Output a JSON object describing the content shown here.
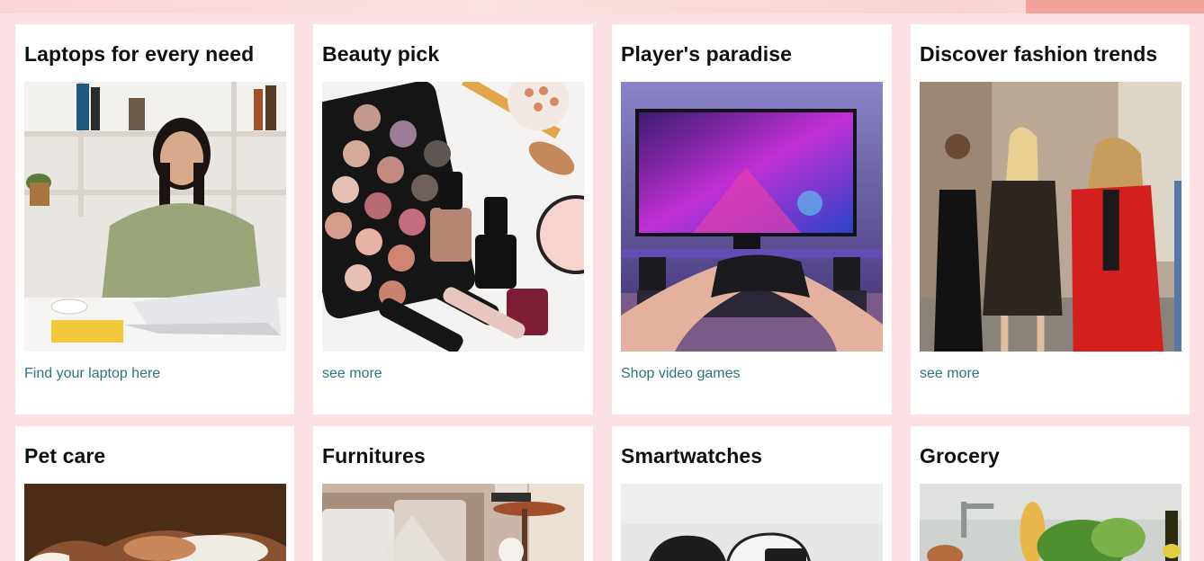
{
  "cards": [
    {
      "title": "Laptops for every need",
      "link": "Find your laptop here",
      "image": "woman-with-laptop-photo"
    },
    {
      "title": "Beauty pick",
      "link": "see more",
      "image": "makeup-products-photo"
    },
    {
      "title": "Player's paradise",
      "link": "Shop video games",
      "image": "gamer-with-controller-photo"
    },
    {
      "title": "Discover fashion trends",
      "link": "see more",
      "image": "fashion-street-style-photo"
    },
    {
      "title": "Pet care",
      "image": "pet-photo"
    },
    {
      "title": "Furnitures",
      "image": "living-room-furniture-photo"
    },
    {
      "title": "Smartwatches",
      "image": "smartwatches-photo"
    },
    {
      "title": "Grocery",
      "image": "grocery-bag-photo"
    }
  ],
  "colors": {
    "page_background": "#fbe0e4",
    "card_background": "#ffffff",
    "link": "#2a7480",
    "title": "#0f1111"
  }
}
